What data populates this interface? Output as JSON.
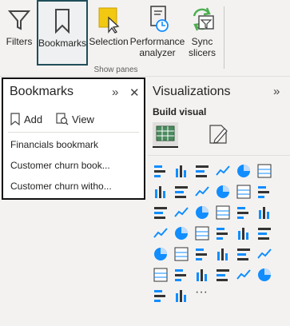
{
  "ribbon": {
    "buttons": [
      {
        "id": "filters",
        "label": "Filters"
      },
      {
        "id": "bookmarks",
        "label": "Bookmarks"
      },
      {
        "id": "selection",
        "label": "Selection"
      },
      {
        "id": "performance",
        "label": "Performance analyzer"
      },
      {
        "id": "sync",
        "label": "Sync slicers"
      }
    ],
    "group_label": "Show panes"
  },
  "bookmarks_pane": {
    "title": "Bookmarks",
    "add_label": "Add",
    "view_label": "View",
    "items": [
      "Financials bookmark",
      "Customer churn book...",
      "Customer churn witho..."
    ]
  },
  "visualizations_pane": {
    "title": "Visualizations",
    "subtitle": "Build visual",
    "more": "···",
    "icons": [
      "stacked-bar-chart-icon",
      "clustered-column-chart-icon",
      "clustered-bar-chart-icon",
      "stacked-column-chart-icon",
      "100-stacked-bar-chart-icon",
      "100-stacked-column-chart-icon",
      "line-chart-icon",
      "area-chart-icon",
      "stacked-area-chart-icon",
      "line-and-column-chart-icon",
      "line-and-stacked-column-chart-icon",
      "ribbon-chart-icon",
      "waterfall-chart-icon",
      "funnel-chart-icon",
      "scatter-chart-icon",
      "pie-chart-icon",
      "donut-chart-icon",
      "treemap-icon",
      "map-icon",
      "filled-map-icon",
      "gauge-icon",
      "card-icon",
      "multi-row-card-icon",
      "kpi-icon",
      "slicer-icon",
      "table-icon",
      "matrix-icon",
      "r-visual-icon",
      "python-visual-icon",
      "key-influencers-icon",
      "decomposition-tree-icon",
      "qna-icon",
      "paginated-report-icon",
      "goals-icon",
      "report-builder-icon",
      "power-automate-icon",
      "power-apps-icon",
      "get-more-visuals-icon"
    ]
  },
  "colors": {
    "accent": "#118dff",
    "dark": "#1f4e5a",
    "gray": "#605e5c",
    "yellow": "#f2c811",
    "green": "#4caf50",
    "orange": "#e66c37"
  }
}
